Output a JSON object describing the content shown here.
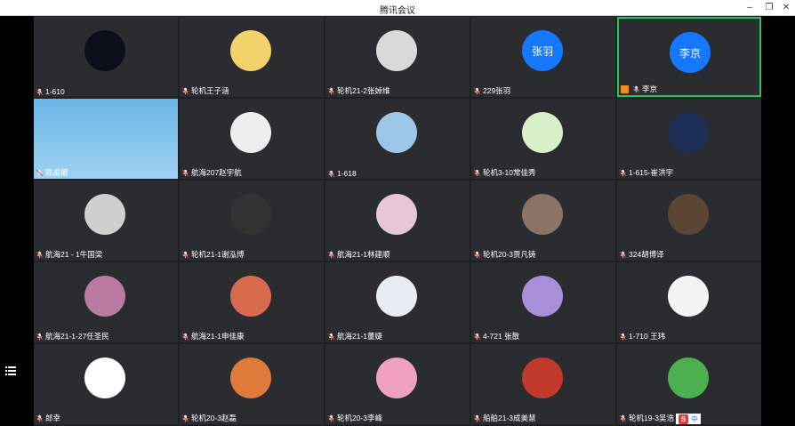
{
  "window": {
    "title": "腾讯会议"
  },
  "tiles": [
    {
      "name": "1-610"
    },
    {
      "name": "轮机王子涵"
    },
    {
      "name": "轮机21-2张婥维"
    },
    {
      "name": "229张羽",
      "avatar_text": "张羽"
    },
    {
      "name": "李京",
      "avatar_text": "李京",
      "active": true
    },
    {
      "name": "陈禹娜",
      "video": true
    },
    {
      "name": "航海207赵宇航"
    },
    {
      "name": "1-618"
    },
    {
      "name": "轮机3-10常佳秀"
    },
    {
      "name": "1-615-崔洪宇"
    },
    {
      "name": "航海21 - 1牛国梁"
    },
    {
      "name": "轮机21-1谢泓博"
    },
    {
      "name": "航海21-1林建顺"
    },
    {
      "name": "轮机20-3贾凡铸"
    },
    {
      "name": "324胡博译"
    },
    {
      "name": "航海21-1-27任圣民"
    },
    {
      "name": "航海21-1申佳康"
    },
    {
      "name": "航海21-1董婕"
    },
    {
      "name": "4-721 张散"
    },
    {
      "name": "1-710 王玮"
    },
    {
      "name": "郎幸"
    },
    {
      "name": "轮机20-3赵磊"
    },
    {
      "name": "轮机20-3李峰"
    },
    {
      "name": "船舶21-3成美慧"
    },
    {
      "name": "轮机19-3吴浩"
    }
  ],
  "ime": {
    "brand": "S",
    "label": "中"
  },
  "colors": {
    "active_border": "#22c55e",
    "avatar_blue": "#1677ff",
    "tile_bg": "#2b2c2f"
  }
}
